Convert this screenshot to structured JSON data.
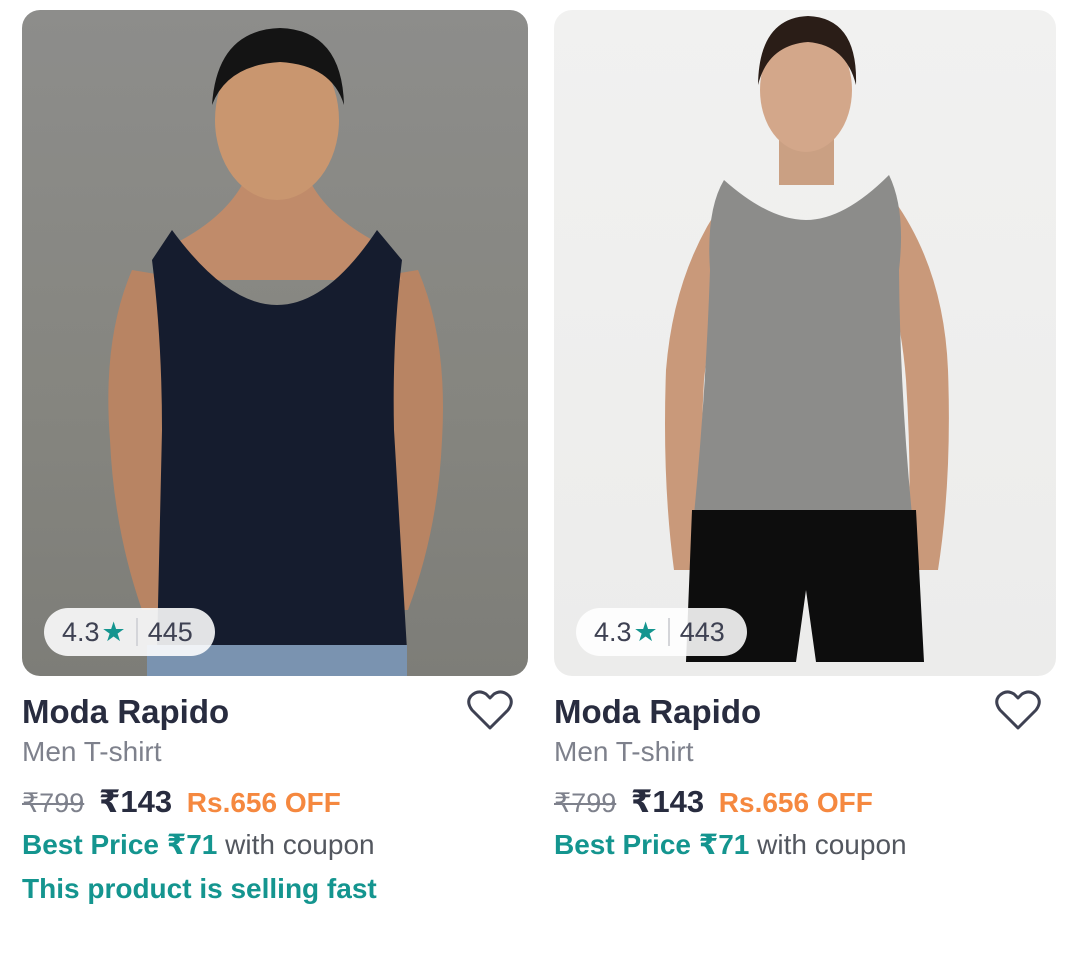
{
  "products": [
    {
      "rating": "4.3",
      "rating_count": "445",
      "brand": "Moda Rapido",
      "subtitle": "Men T-shirt",
      "mrp": "₹799",
      "price": "₹143",
      "discount": "Rs.656 OFF",
      "best_price_label": "Best Price ₹71",
      "best_price_suffix": " with coupon",
      "urgency": "This product is selling fast",
      "tank_color": "#151c2e"
    },
    {
      "rating": "4.3",
      "rating_count": "443",
      "brand": "Moda Rapido",
      "subtitle": "Men T-shirt",
      "mrp": "₹799",
      "price": "₹143",
      "discount": "Rs.656 OFF",
      "best_price_label": "Best Price ₹71",
      "best_price_suffix": " with coupon",
      "tank_color": "#8c8c8a"
    }
  ],
  "colors": {
    "accent_green": "#14958f",
    "discount_orange": "#f5883f",
    "star": "#14958f"
  },
  "icons": {
    "rating": "star-icon",
    "wishlist": "heart-outline-icon"
  }
}
